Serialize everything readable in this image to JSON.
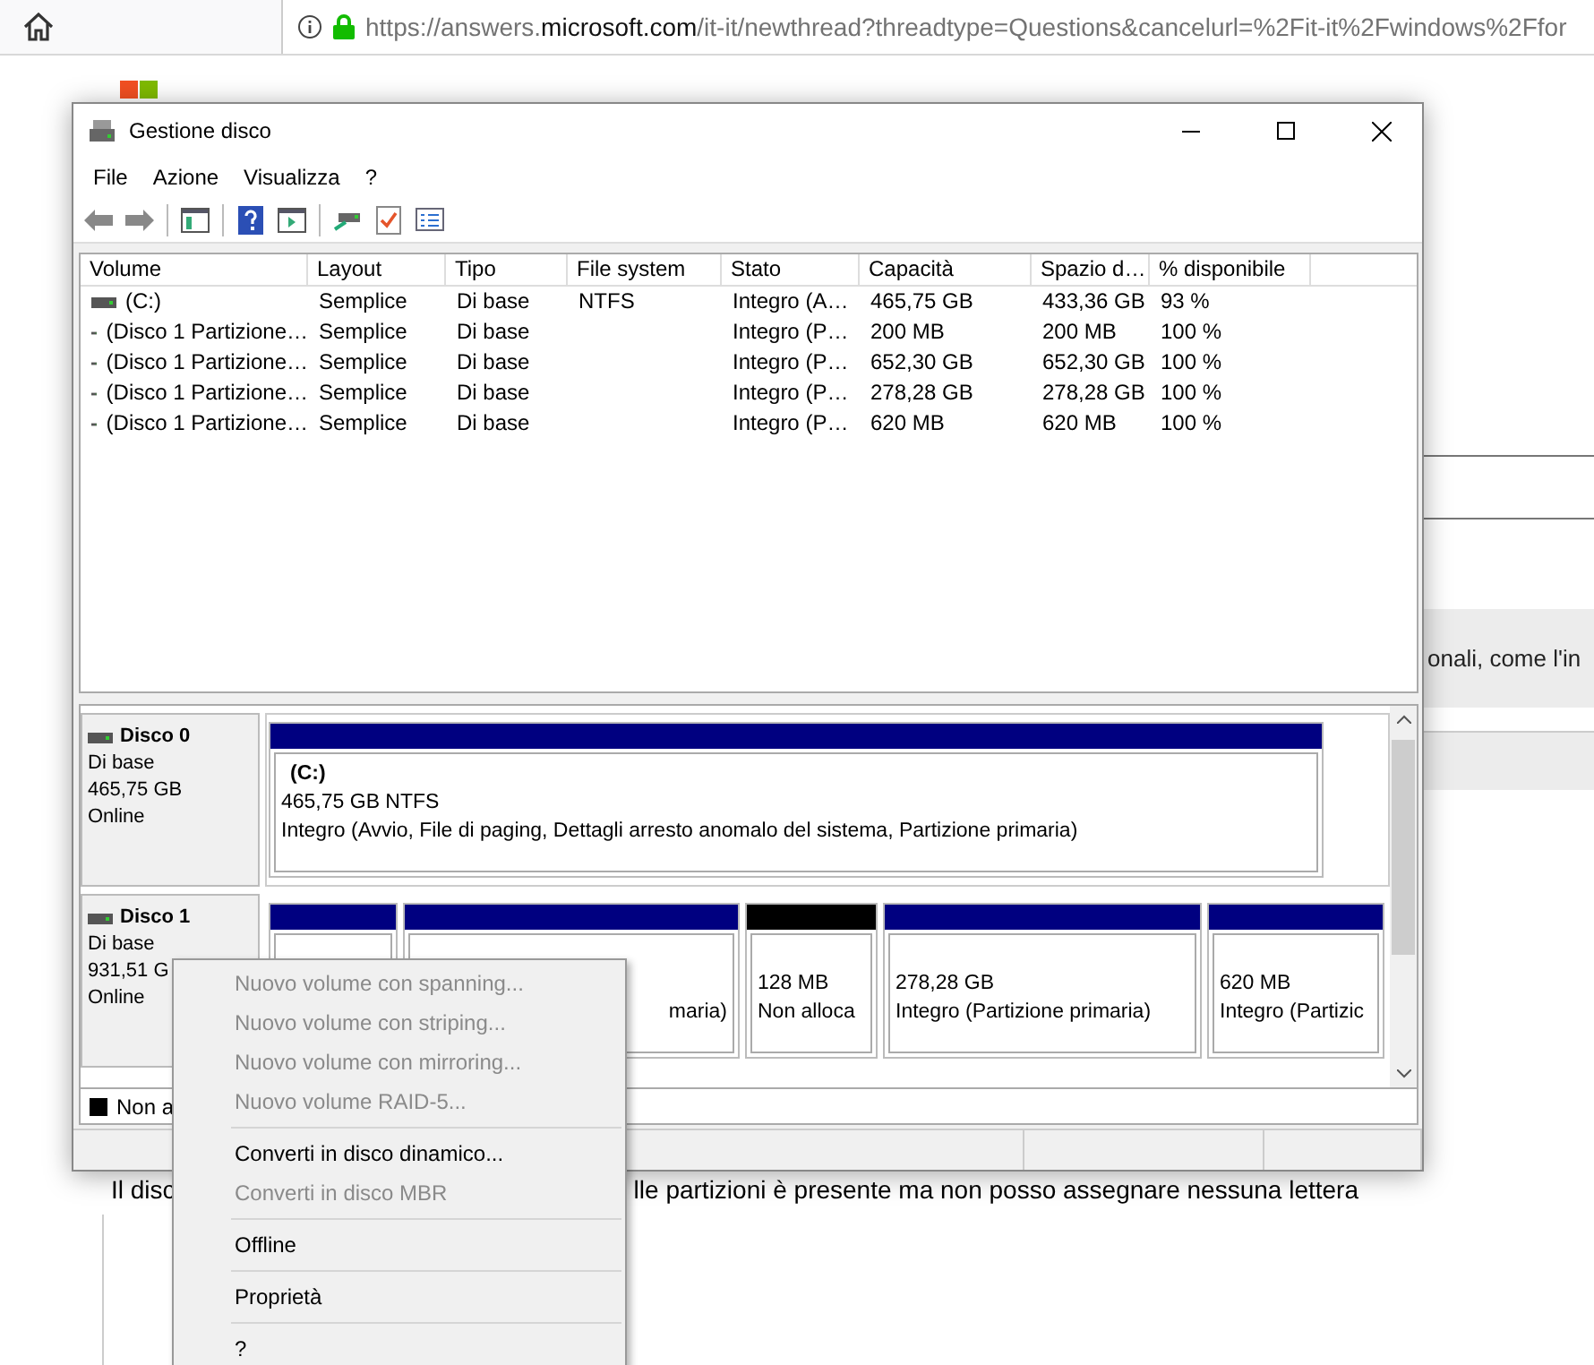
{
  "browser": {
    "url": {
      "scheme": "https://answers.",
      "domain": "microsoft.com",
      "path": "/it-it/newthread?threadtype=Questions&cancelurl=%2Fit-it%2Fwindows%2Ffor"
    }
  },
  "page": {
    "snippet": "onali, come l'in",
    "body_text": [
      "Il disc",
      "lle partizioni è presente ma non posso assegnare nessuna lettera"
    ]
  },
  "window": {
    "title": "Gestione disco",
    "menu": [
      "File",
      "Azione",
      "Visualizza",
      "?"
    ]
  },
  "volume_table": {
    "columns": [
      "Volume",
      "Layout",
      "Tipo",
      "File system",
      "Stato",
      "Capacità",
      "Spazio d…",
      "% disponibile"
    ],
    "rows": [
      {
        "cells": [
          "(C:)",
          "Semplice",
          "Di base",
          "NTFS",
          "Integro (A…",
          "465,75 GB",
          "433,36 GB",
          "93 %"
        ]
      },
      {
        "cells": [
          "(Disco 1 Partizione…",
          "Semplice",
          "Di base",
          "",
          "Integro (P…",
          "200 MB",
          "200 MB",
          "100 %"
        ]
      },
      {
        "cells": [
          "(Disco 1 Partizione…",
          "Semplice",
          "Di base",
          "",
          "Integro (P…",
          "652,30 GB",
          "652,30 GB",
          "100 %"
        ]
      },
      {
        "cells": [
          "(Disco 1 Partizione…",
          "Semplice",
          "Di base",
          "",
          "Integro (P…",
          "278,28 GB",
          "278,28 GB",
          "100 %"
        ]
      },
      {
        "cells": [
          "(Disco 1 Partizione…",
          "Semplice",
          "Di base",
          "",
          "Integro (P…",
          "620 MB",
          "620 MB",
          "100 %"
        ]
      }
    ]
  },
  "disks": [
    {
      "name": "Disco 0",
      "details": [
        "Di base",
        "465,75 GB",
        "Online"
      ],
      "partitions": [
        {
          "kind": "primary",
          "name": "(C:)",
          "lines": [
            "465,75 GB NTFS",
            "Integro (Avvio, File di paging, Dettagli arresto anomalo del sistema, Partizione primaria)"
          ]
        }
      ]
    },
    {
      "name": "Disco 1",
      "details": [
        "Di base",
        "931,51 G",
        "Online"
      ],
      "partitions": [
        {
          "kind": "primary"
        },
        {
          "kind": "primary",
          "covered": true,
          "lines": [
            "maria)"
          ]
        },
        {
          "kind": "unallocated",
          "lines": [
            "128 MB",
            "Non alloca"
          ]
        },
        {
          "kind": "primary",
          "lines": [
            "278,28 GB",
            "Integro (Partizione primaria)"
          ]
        },
        {
          "kind": "primary",
          "lines": [
            "620 MB",
            "Integro (Partizic"
          ]
        }
      ]
    }
  ],
  "legend": [
    {
      "label": "Non a",
      "color": "#000000"
    }
  ],
  "context_menu": [
    {
      "kind": "item",
      "label": "Nuovo volume con spanning...",
      "disabled": true
    },
    {
      "kind": "item",
      "label": "Nuovo volume con striping...",
      "disabled": true
    },
    {
      "kind": "item",
      "label": "Nuovo volume con mirroring...",
      "disabled": true
    },
    {
      "kind": "item",
      "label": "Nuovo volume RAID-5...",
      "disabled": true
    },
    {
      "kind": "separator"
    },
    {
      "kind": "item",
      "label": "Converti in disco dinamico...",
      "disabled": false
    },
    {
      "kind": "item",
      "label": "Converti in disco MBR",
      "disabled": true
    },
    {
      "kind": "separator"
    },
    {
      "kind": "item",
      "label": "Offline",
      "disabled": false
    },
    {
      "kind": "separator"
    },
    {
      "kind": "item",
      "label": "Proprietà",
      "disabled": false
    },
    {
      "kind": "separator"
    },
    {
      "kind": "item",
      "label": "?",
      "disabled": false
    }
  ]
}
